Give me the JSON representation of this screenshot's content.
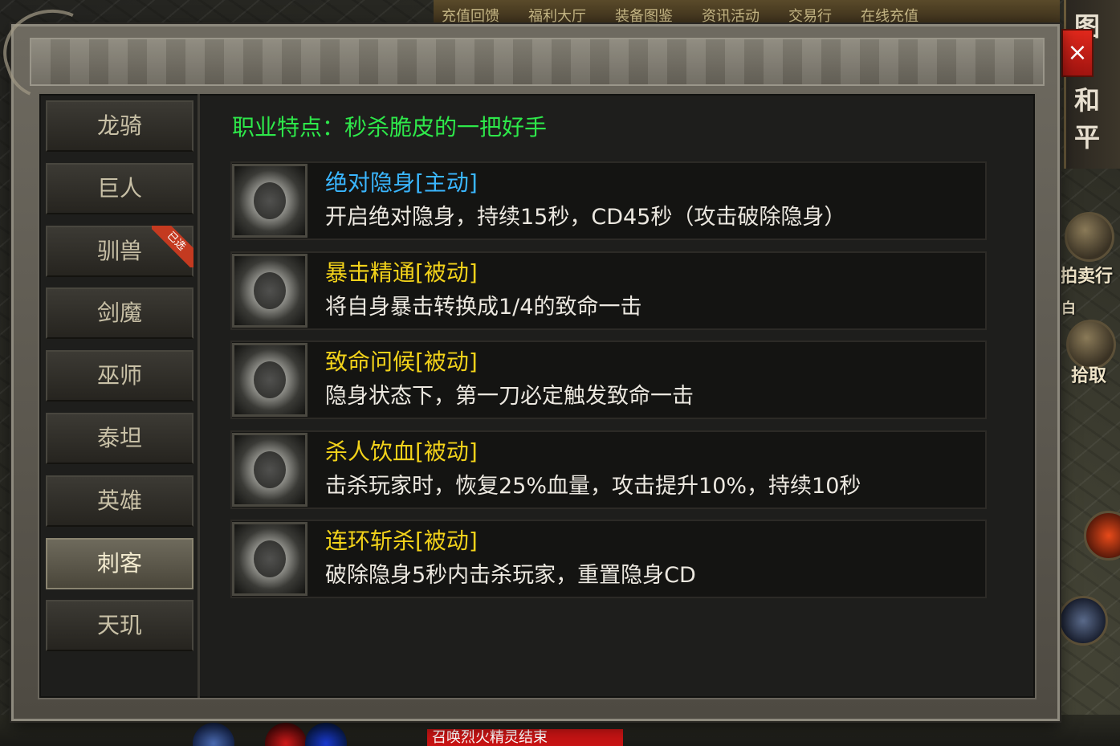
{
  "top_menu": [
    "充值回馈",
    "福利大厅",
    "装备图鉴",
    "资讯活动",
    "交易行",
    "在线充值"
  ],
  "side_chars": [
    "图",
    "和",
    "平"
  ],
  "close_symbol": "×",
  "right_buttons": [
    {
      "label": "拍卖行",
      "icon": "book-icon"
    },
    {
      "label": "白",
      "icon": ""
    },
    {
      "label": "拾取",
      "icon": "hand-icon"
    }
  ],
  "bottom_notice": "召唤烈火精灵结束",
  "classes": [
    {
      "label": "龙骑",
      "active": false,
      "badge": ""
    },
    {
      "label": "巨人",
      "active": false,
      "badge": ""
    },
    {
      "label": "驯兽",
      "active": false,
      "badge": "已选"
    },
    {
      "label": "剑魔",
      "active": false,
      "badge": ""
    },
    {
      "label": "巫师",
      "active": false,
      "badge": ""
    },
    {
      "label": "泰坦",
      "active": false,
      "badge": ""
    },
    {
      "label": "英雄",
      "active": false,
      "badge": ""
    },
    {
      "label": "刺客",
      "active": true,
      "badge": ""
    },
    {
      "label": "天玑",
      "active": false,
      "badge": ""
    }
  ],
  "trait": "职业特点：秒杀脆皮的一把好手",
  "skills": [
    {
      "name": "绝对隐身[主动]",
      "desc": "开启绝对隐身，持续15秒，CD45秒（攻击破除隐身）",
      "color": "#3ab6ff",
      "icon": "stealth-icon"
    },
    {
      "name": "暴击精通[被动]",
      "desc": "将自身暴击转换成1/4的致命一击",
      "color": "#f2d21a",
      "icon": "critical-mastery-icon"
    },
    {
      "name": "致命问候[被动]",
      "desc": "隐身状态下，第一刀必定触发致命一击",
      "color": "#f2d21a",
      "icon": "deadly-greeting-icon"
    },
    {
      "name": "杀人饮血[被动]",
      "desc": "击杀玩家时，恢复25%血量，攻击提升10%，持续10秒",
      "color": "#f2d21a",
      "icon": "bloodthirst-icon"
    },
    {
      "name": "连环斩杀[被动]",
      "desc": "破除隐身5秒内击杀玩家，重置隐身CD",
      "color": "#f2d21a",
      "icon": "chain-kill-icon"
    }
  ]
}
